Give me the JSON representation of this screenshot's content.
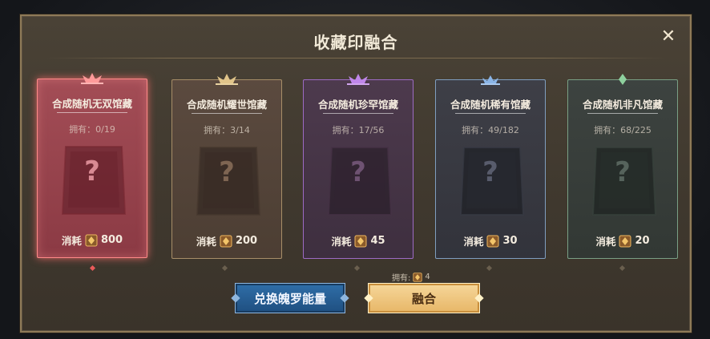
{
  "dialog": {
    "title": "收藏印融合",
    "close_icon": "close-icon"
  },
  "cards": [
    {
      "name": "合成随机无双馆藏",
      "owned": "拥有：0/19",
      "cost_label": "消耗",
      "cost_value": "800",
      "accent": "#ff8a88",
      "selected": true
    },
    {
      "name": "合成随机耀世馆藏",
      "owned": "拥有：3/14",
      "cost_label": "消耗",
      "cost_value": "200",
      "accent": "#d8bb84",
      "selected": false
    },
    {
      "name": "合成随机珍罕馆藏",
      "owned": "拥有：17/56",
      "cost_label": "消耗",
      "cost_value": "45",
      "accent": "#b27ddd",
      "selected": false
    },
    {
      "name": "合成随机稀有馆藏",
      "owned": "拥有：49/182",
      "cost_label": "消耗",
      "cost_value": "30",
      "accent": "#8ab4e6",
      "selected": false
    },
    {
      "name": "合成随机非凡馆藏",
      "owned": "拥有：68/225",
      "cost_label": "消耗",
      "cost_value": "20",
      "accent": "#8ed09e",
      "selected": false
    }
  ],
  "mystery_mark": "?",
  "resource": {
    "owned_label": "拥有:",
    "owned_value": "4",
    "icon": "seal-currency-icon"
  },
  "buttons": {
    "exchange_label": "兑换魄罗能量",
    "fuse_label": "融合"
  }
}
